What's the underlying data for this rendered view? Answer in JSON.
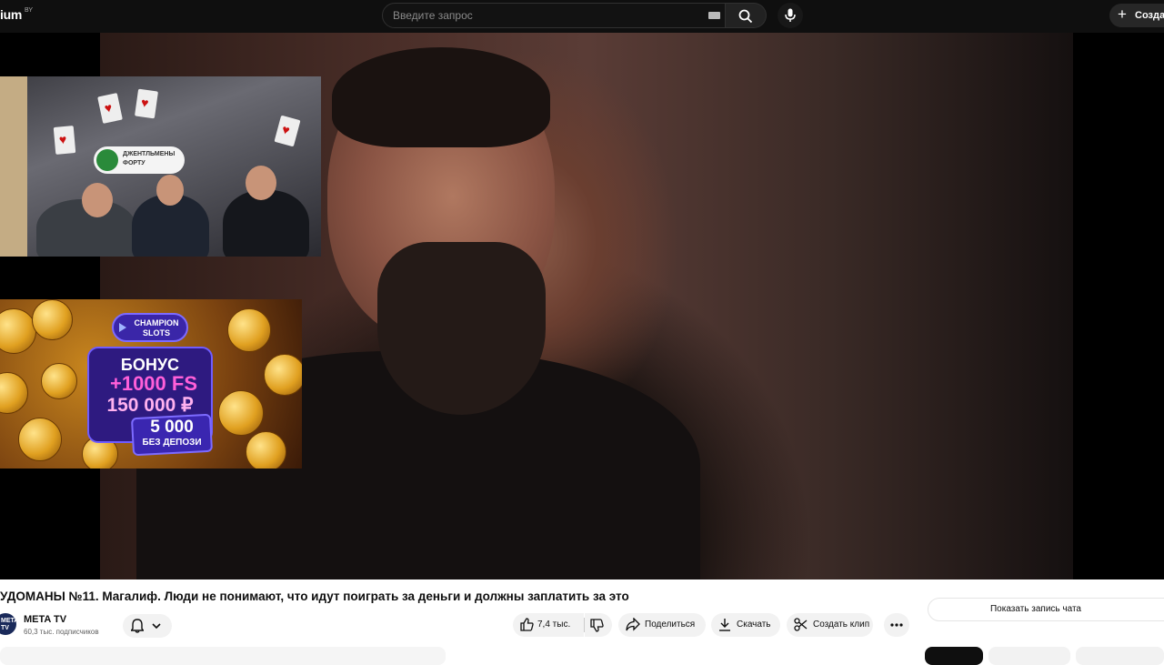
{
  "header": {
    "logo_text": "ium",
    "logo_region": "BY",
    "search_placeholder": "Введите запрос",
    "create_label": "Создать"
  },
  "ad": {
    "brand": "CHAMPION SLOTS",
    "bonus": "БОНУС",
    "freespins": "+1000 FS",
    "amount": "150 000 ₽",
    "deposit_free": "5 000",
    "no_deposit": "БЕЗ ДЕПОЗИ"
  },
  "pip": {
    "brand": "ДЖЕНТЛЬМЕНЫ ФОРТУ"
  },
  "video": {
    "title": "УДОМАНЫ №11. Магалиф. Люди не понимают, что идут поиграть за деньги и должны заплатить за это"
  },
  "channel": {
    "avatar_text": "META TV",
    "name": "META TV",
    "subscribers": "60,3 тыс. подписчиков"
  },
  "actions": {
    "likes": "7,4 тыс.",
    "share": "Поделиться",
    "download": "Скачать",
    "clip": "Создать клип"
  },
  "chat": {
    "show_replay": "Показать запись чата"
  },
  "colors": {
    "topbar_bg": "#0f0f0f",
    "chip_bg": "#f2f2f2",
    "ad_purple": "#2e1a80"
  }
}
